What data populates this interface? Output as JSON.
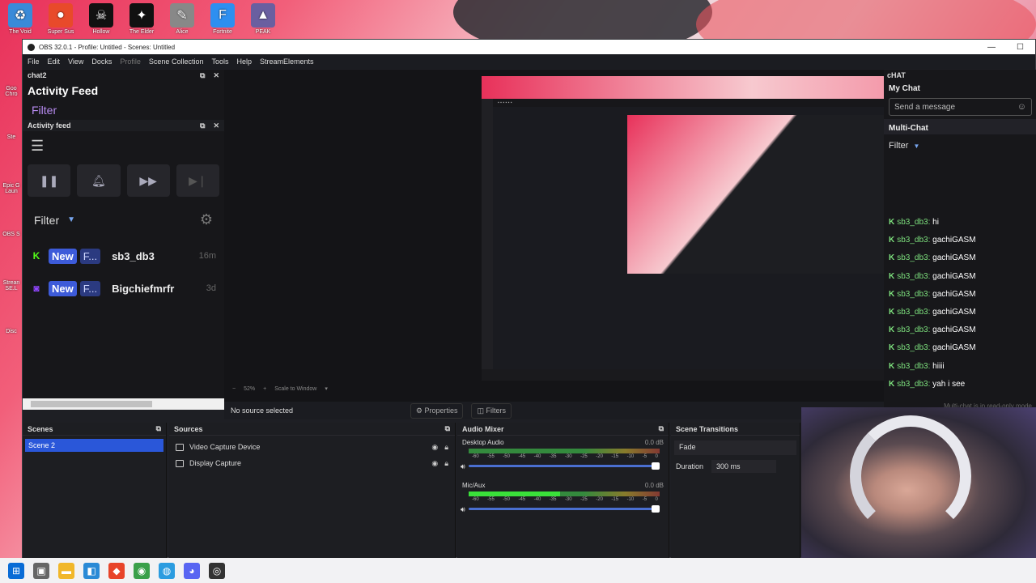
{
  "colors": {
    "accent": "#3d5bd9",
    "scene_selected": "#2a57d9",
    "chat_green": "#7de07d",
    "filter_purple": "#b78bf0"
  },
  "desktop": {
    "icons": [
      {
        "label": "The Void",
        "color": "#3a8ad8",
        "glyph": "♻"
      },
      {
        "label": "Super Sus",
        "color": "#e84a2a",
        "glyph": "●"
      },
      {
        "label": "Hollow",
        "color": "#111",
        "glyph": "☠"
      },
      {
        "label": "The Elder",
        "color": "#111",
        "glyph": "✦"
      },
      {
        "label": "Alice",
        "color": "#888",
        "glyph": "✎"
      },
      {
        "label": "Fortnite",
        "color": "#2d8ff0",
        "glyph": "F"
      },
      {
        "label": "PEAK",
        "color": "#6a5fa0",
        "glyph": "▲"
      }
    ],
    "left_icons": [
      "Goo Chro",
      "Ste",
      "Epic G Laun",
      "OBS S",
      "Strean SE.L",
      "Disc"
    ]
  },
  "window": {
    "title": "OBS 32.0.1 - Profile: Untitled - Scenes: Untitled",
    "minimize": "—",
    "maximize": "☐"
  },
  "menu": [
    "File",
    "Edit",
    "View",
    "Docks",
    "Profile",
    "Scene Collection",
    "Tools",
    "Help",
    "StreamElements"
  ],
  "chat2": {
    "dock_title": "chat2",
    "heading": "Activity Feed",
    "filter_link": "Filter",
    "sub_dock_title": "Activity feed",
    "menu_icon": "☰",
    "controls": [
      "pause-icon",
      "bell-icon",
      "fast-forward-icon",
      "skip-icon"
    ],
    "filter_label": "Filter",
    "events": [
      {
        "platform": "kick",
        "platform_glyph": "K",
        "platform_color": "#53fc18",
        "badge": "New",
        "tag": "F...",
        "name": "sb3_db3",
        "ago": "16m"
      },
      {
        "platform": "twitch",
        "platform_glyph": "◙",
        "platform_color": "#9146ff",
        "badge": "New",
        "tag": "F...",
        "name": "Bigchiefmrfr",
        "ago": "3d"
      }
    ]
  },
  "preview": {
    "zoom": "52%",
    "scale_mode": "Scale to Window",
    "nested_chat": [
      "sb3_db3: hi",
      "sb3_db3: gachiGASM",
      "sb3_db3: gachiGASM",
      "sb3_db3: gachiGASM",
      "sb3_db3: gachiGASM",
      "sb3_db3: gachiGASM",
      "sb3_db3: gachiGASM",
      "sb3_db3: gachiGASM",
      "sb3_db3: hiiii",
      "sb3_db3: yah i see"
    ]
  },
  "right_chat": {
    "dock_title": "cHAT",
    "title": "My Chat",
    "input_placeholder": "Send a message",
    "multi_title": "Multi-Chat",
    "filter_label": "Filter",
    "messages": [
      {
        "user": "sb3_db3:",
        "text": "hi"
      },
      {
        "user": "sb3_db3:",
        "text": "gachiGASM"
      },
      {
        "user": "sb3_db3:",
        "text": "gachiGASM"
      },
      {
        "user": "sb3_db3:",
        "text": "gachiGASM"
      },
      {
        "user": "sb3_db3:",
        "text": "gachiGASM"
      },
      {
        "user": "sb3_db3:",
        "text": "gachiGASM"
      },
      {
        "user": "sb3_db3:",
        "text": "gachiGASM"
      },
      {
        "user": "sb3_db3:",
        "text": "gachiGASM"
      },
      {
        "user": "sb3_db3:",
        "text": "hiiii"
      },
      {
        "user": "sb3_db3:",
        "text": "yah i see"
      }
    ],
    "footer": "Multi-chat is in read-only mode"
  },
  "source_toolbar": {
    "status": "No source selected",
    "properties": "Properties",
    "filters": "Filters"
  },
  "scenes": {
    "title": "Scenes",
    "items": [
      "Scene 2"
    ]
  },
  "sources": {
    "title": "Sources",
    "items": [
      {
        "name": "Video Capture Device",
        "icon": "camera-icon"
      },
      {
        "name": "Display Capture",
        "icon": "monitor-icon"
      }
    ]
  },
  "mixer": {
    "title": "Audio Mixer",
    "scale": [
      "-60",
      "-55",
      "-50",
      "-45",
      "-40",
      "-35",
      "-30",
      "-25",
      "-20",
      "-15",
      "-10",
      "-5",
      "0"
    ],
    "channels": [
      {
        "name": "Desktop Audio",
        "db": "0.0 dB",
        "level": 0
      },
      {
        "name": "Mic/Aux",
        "db": "0.0 dB",
        "level": 0.48
      }
    ]
  },
  "transitions": {
    "title": "Scene Transitions",
    "selected": "Fade",
    "duration_label": "Duration",
    "duration": "300 ms"
  },
  "taskbar": [
    {
      "name": "start",
      "color": "#0a6cd6",
      "glyph": "⊞"
    },
    {
      "name": "search",
      "color": "#666",
      "glyph": "▣"
    },
    {
      "name": "explorer",
      "color": "#f1b72a",
      "glyph": "▬"
    },
    {
      "name": "store",
      "color": "#2a8ad6",
      "glyph": "◧"
    },
    {
      "name": "app-red",
      "color": "#e8442a",
      "glyph": "◆"
    },
    {
      "name": "chrome",
      "color": "#3aa04a",
      "glyph": "◉"
    },
    {
      "name": "edge",
      "color": "#2b9ce0",
      "glyph": "◍"
    },
    {
      "name": "discord",
      "color": "#5865f2",
      "glyph": "◕"
    },
    {
      "name": "obs",
      "color": "#333",
      "glyph": "◎"
    }
  ]
}
